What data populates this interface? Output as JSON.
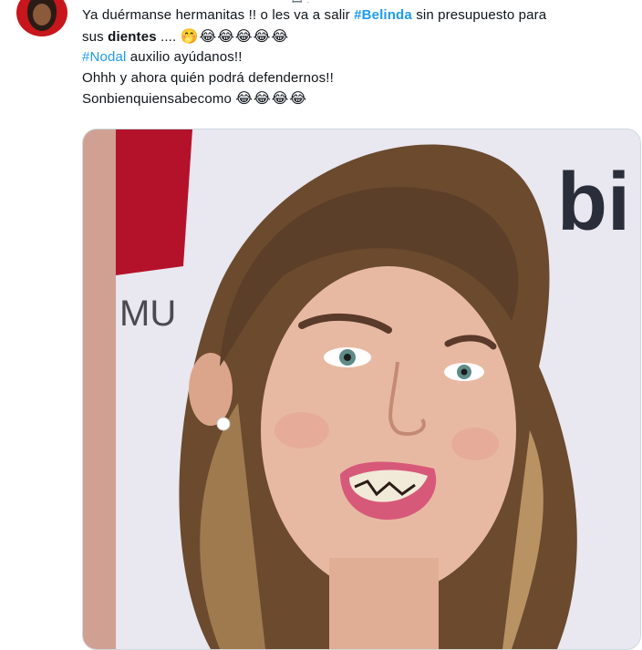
{
  "header": {
    "partial_text": "ꟷ ·"
  },
  "author": {
    "avatar_icon": "profile-avatar"
  },
  "tweet": {
    "line1_prefix": "Ya duérmanse hermanitas !! o les va a salir ",
    "hashtag1": "#Belinda",
    "line1_suffix": " sin presupuesto para",
    "line2_prefix": "sus ",
    "line2_bold": "dientes",
    "line2_suffix": " .... ",
    "line2_emoji": "🤭😂😂😂😂😂",
    "hashtag2": "#Nodal",
    "line3_suffix": " auxilio ayúdanos!!",
    "line4": "Ohhh y ahora quién podrá defendernos!!",
    "line5": "Sonbienquiensabecomo ",
    "line5_emoji": "😂😂😂😂"
  },
  "media": {
    "backdrop_letters_left": "MU",
    "backdrop_letters_right": "bi",
    "colors": {
      "backdrop": "#e9e7ef",
      "red_strip": "#b4122a",
      "hair": "#6b4a2e",
      "skin": "#e8b9a2"
    }
  }
}
